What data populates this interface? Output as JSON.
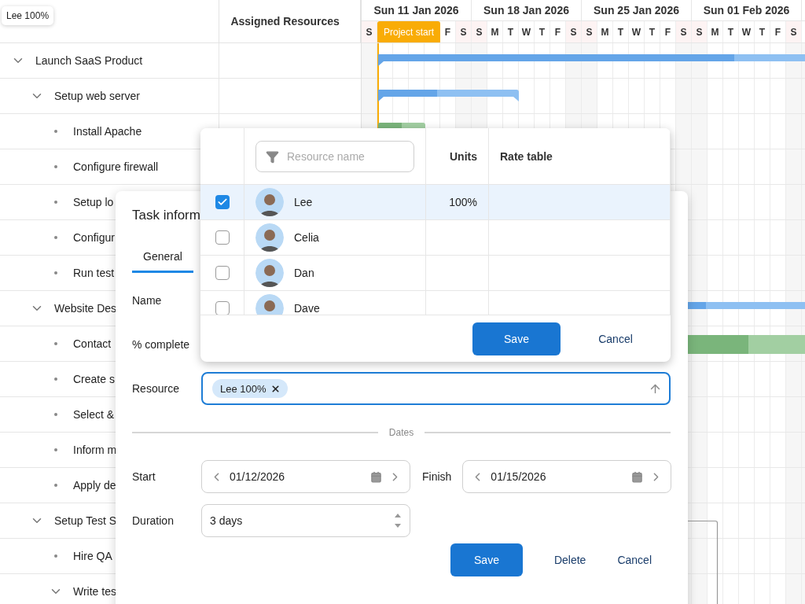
{
  "tooltip": {
    "text": "Lee 100%"
  },
  "grid": {
    "resource_header": "Assigned Resources"
  },
  "timeline": {
    "weeks": [
      "Sun 11 Jan 2026",
      "Sun 18 Jan 2026",
      "Sun 25 Jan 2026",
      "Sun 01 Feb 2026"
    ],
    "days": [
      {
        "kind": "day",
        "label": "S",
        "weekend": true
      },
      {
        "kind": "marker",
        "label": "Project start"
      },
      {
        "kind": "day",
        "label": "F",
        "weekend": false
      },
      {
        "kind": "day",
        "label": "S",
        "weekend": true
      },
      {
        "kind": "day",
        "label": "S",
        "weekend": true
      },
      {
        "kind": "day",
        "label": "M",
        "weekend": false
      },
      {
        "kind": "day",
        "label": "T",
        "weekend": false
      },
      {
        "kind": "day",
        "label": "W",
        "weekend": false
      },
      {
        "kind": "day",
        "label": "T",
        "weekend": false
      },
      {
        "kind": "day",
        "label": "F",
        "weekend": false
      },
      {
        "kind": "day",
        "label": "S",
        "weekend": true
      },
      {
        "kind": "day",
        "label": "S",
        "weekend": true
      },
      {
        "kind": "day",
        "label": "M",
        "weekend": false
      },
      {
        "kind": "day",
        "label": "T",
        "weekend": false
      },
      {
        "kind": "day",
        "label": "W",
        "weekend": false
      },
      {
        "kind": "day",
        "label": "T",
        "weekend": false
      },
      {
        "kind": "day",
        "label": "F",
        "weekend": false
      },
      {
        "kind": "day",
        "label": "S",
        "weekend": true
      },
      {
        "kind": "day",
        "label": "S",
        "weekend": true
      },
      {
        "kind": "day",
        "label": "M",
        "weekend": false
      },
      {
        "kind": "day",
        "label": "T",
        "weekend": false
      },
      {
        "kind": "day",
        "label": "W",
        "weekend": false
      },
      {
        "kind": "day",
        "label": "T",
        "weekend": false
      },
      {
        "kind": "day",
        "label": "F",
        "weekend": false
      },
      {
        "kind": "day",
        "label": "S",
        "weekend": true
      }
    ]
  },
  "tasks": [
    {
      "name": "Launch SaaS Product",
      "expanded": true,
      "bar": {
        "kind": "summary",
        "level": 0.81
      },
      "children": [
        {
          "name": "Setup web server",
          "expanded": true,
          "bar": {
            "kind": "summary",
            "level": 0.42
          },
          "children": [
            {
              "name": "Install Apache",
              "bar": {
                "kind": "task",
                "level": 0.5
              }
            },
            {
              "name": "Configure firewall"
            },
            {
              "name": "Setup lo"
            },
            {
              "name": "Configur"
            },
            {
              "name": "Run test"
            }
          ]
        },
        {
          "name": "Website Des",
          "expanded": true,
          "bar": {
            "kind": "summary",
            "level": 0.7
          },
          "children": [
            {
              "name": "Contact",
              "bar": {
                "kind": "task",
                "level": 0.46
              }
            },
            {
              "name": "Create s"
            },
            {
              "name": "Select &"
            },
            {
              "name": "Inform m"
            },
            {
              "name": "Apply de"
            }
          ]
        },
        {
          "name": "Setup Test S",
          "expanded": true,
          "children": [
            {
              "name": "Hire QA"
            },
            {
              "name": "Write tes",
              "expanded": true
            }
          ]
        }
      ]
    }
  ],
  "task_dialog": {
    "title": "Task inform",
    "tabs": [
      {
        "label": "General",
        "selected": true
      }
    ],
    "fields": [
      {
        "label": "Name"
      },
      {
        "label": "% complete"
      }
    ],
    "resource": {
      "label": "Resource",
      "chips": [
        {
          "text": "Lee 100%"
        }
      ]
    },
    "dates_heading": "Dates",
    "start": {
      "label": "Start",
      "value": "01/12/2026"
    },
    "finish": {
      "label": "Finish",
      "value": "01/15/2026"
    },
    "duration": {
      "label": "Duration",
      "value": "3 days"
    },
    "buttons": [
      {
        "label": "Save",
        "kind": "primary"
      },
      {
        "label": "Delete",
        "kind": "flat"
      },
      {
        "label": "Cancel",
        "kind": "flat"
      }
    ]
  },
  "resource_picker": {
    "filter": {
      "placeholder": "Resource name"
    },
    "columns": [
      {
        "label": "Units"
      },
      {
        "label": "Rate table"
      }
    ],
    "rows": [
      {
        "name": "Lee",
        "units": "100%",
        "checked": true,
        "selected": true
      },
      {
        "name": "Celia",
        "checked": false,
        "selected": false
      },
      {
        "name": "Dan",
        "checked": false,
        "selected": false
      },
      {
        "name": "Dave",
        "checked": false,
        "selected": false
      }
    ],
    "buttons": [
      {
        "label": "Save",
        "kind": "primary"
      },
      {
        "label": "Cancel",
        "kind": "flat"
      }
    ]
  }
}
